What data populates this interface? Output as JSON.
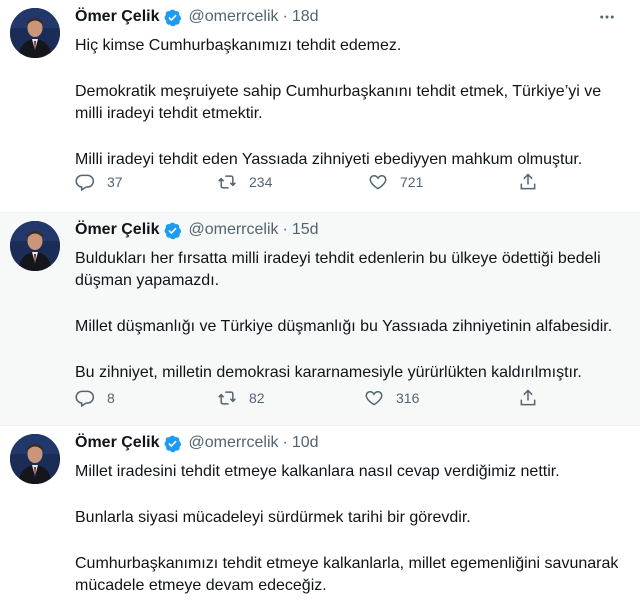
{
  "tweets": [
    {
      "name": "Ömer Çelik",
      "handle": "@omerrcelik",
      "separator": "·",
      "time": "18d",
      "paragraphs": [
        "Hiç kimse Cumhurbaşkanımızı tehdit edemez.",
        "Demokratik meşruiyete sahip Cumhurbaşkanını tehdit etmek, Türkiye’yi ve milli iradeyi tehdit etmektir.",
        "Milli iradeyi tehdit eden Yassıada zihniyeti ebediyyen mahkum olmuştur."
      ],
      "replies": "37",
      "retweets": "234",
      "likes": "721"
    },
    {
      "name": "Ömer Çelik",
      "handle": "@omerrcelik",
      "separator": "·",
      "time": "15d",
      "paragraphs": [
        "Buldukları her fırsatta milli iradeyi tehdit edenlerin bu ülkeye ödettiği bedeli düşman yapamazdı.",
        "Millet düşmanlığı ve Türkiye düşmanlığı bu Yassıada zihniyetinin alfabesidir.",
        "Bu zihniyet, milletin demokrasi kararnamesiyle yürürlükten kaldırılmıştır."
      ],
      "replies": "8",
      "retweets": "82",
      "likes": "316"
    },
    {
      "name": "Ömer Çelik",
      "handle": "@omerrcelik",
      "separator": "·",
      "time": "10d",
      "paragraphs": [
        "Millet iradesini tehdit etmeye kalkanlara nasıl cevap verdiğimiz nettir.",
        "Bunlarla siyasi mücadeleyi sürdürmek tarihi bir görevdir.",
        "Cumhurbaşkanımızı tehdit etmeye kalkanlarla, millet egemenliğini savunarak mücadele etmeye devam edeceğiz."
      ]
    }
  ],
  "icons": {
    "verified": "verified-badge-icon",
    "more": "more-options-icon",
    "reply": "reply-icon",
    "retweet": "retweet-icon",
    "like": "like-icon",
    "share": "share-icon"
  },
  "colors": {
    "verified": "#1d9bf0",
    "secondary_text": "#536471",
    "primary_text": "#0f1419",
    "highlight_bg": "#f7f9f9"
  }
}
